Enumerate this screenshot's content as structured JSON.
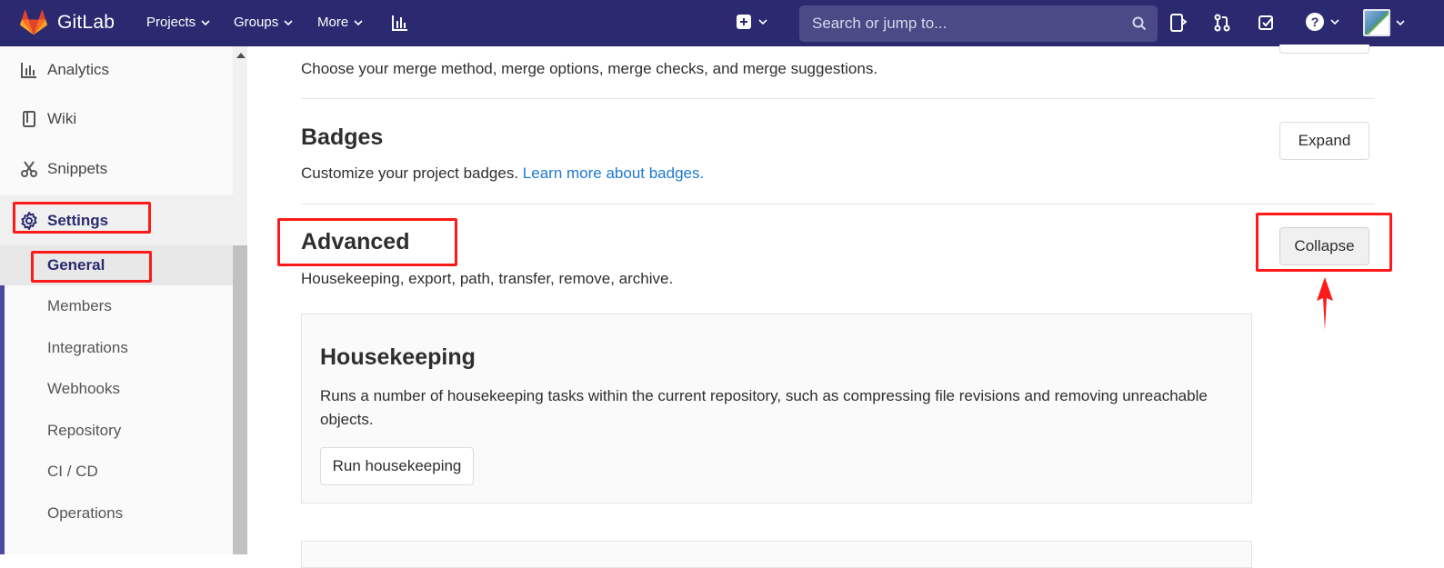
{
  "app": {
    "name": "GitLab"
  },
  "navbar": {
    "links": [
      {
        "label": "Projects"
      },
      {
        "label": "Groups"
      },
      {
        "label": "More"
      }
    ],
    "search_placeholder": "Search or jump to..."
  },
  "sidebar": {
    "items": [
      {
        "label": "Analytics",
        "icon": "analytics-icon"
      },
      {
        "label": "Wiki",
        "icon": "book-icon"
      },
      {
        "label": "Snippets",
        "icon": "scissors-icon"
      },
      {
        "label": "Settings",
        "icon": "gear-icon",
        "active": true
      }
    ],
    "settings_subitems": [
      {
        "label": "General",
        "active": true
      },
      {
        "label": "Members"
      },
      {
        "label": "Integrations"
      },
      {
        "label": "Webhooks"
      },
      {
        "label": "Repository"
      },
      {
        "label": "CI / CD"
      },
      {
        "label": "Operations"
      }
    ]
  },
  "main": {
    "merge_desc": "Choose your merge method, merge options, merge checks, and merge suggestions.",
    "badges": {
      "title": "Badges",
      "desc": "Customize your project badges.",
      "link": "Learn more about badges.",
      "button": "Expand"
    },
    "advanced": {
      "title": "Advanced",
      "desc": "Housekeeping, export, path, transfer, remove, archive.",
      "button": "Collapse"
    },
    "housekeeping": {
      "title": "Housekeeping",
      "desc": "Runs a number of housekeeping tasks within the current repository, such as compressing file revisions and removing unreachable objects.",
      "button": "Run housekeeping"
    }
  },
  "colors": {
    "navbar_bg": "#2b2a70",
    "link": "#1f78d1",
    "annotation": "#ff1a1a"
  }
}
